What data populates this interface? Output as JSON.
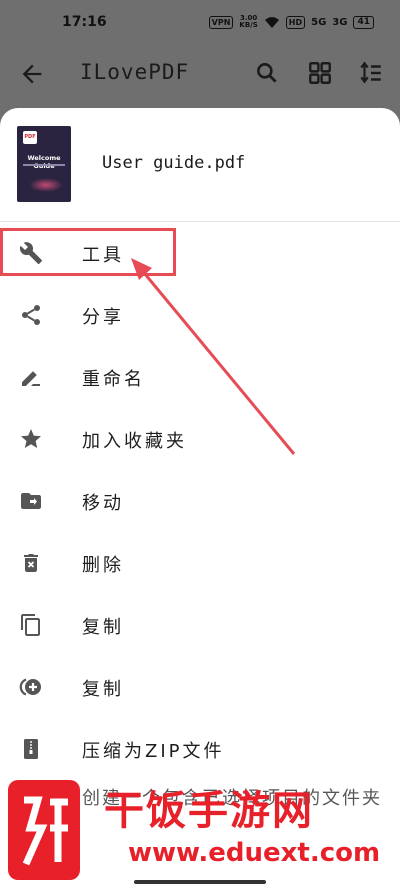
{
  "status": {
    "time": "17:16",
    "vpn": "VPN",
    "speed": "3.00\nKB/S",
    "hd": "HD",
    "net1": "5G",
    "net2": "3G",
    "battery": "41"
  },
  "appbar": {
    "title": "ILovePDF"
  },
  "file": {
    "name": "User guide.pdf",
    "thumb_title": "Welcome Guide",
    "thumb_logo": "PDF"
  },
  "menu": [
    {
      "label": "工具"
    },
    {
      "label": "分享"
    },
    {
      "label": "重命名"
    },
    {
      "label": "加入收藏夹"
    },
    {
      "label": "移动"
    },
    {
      "label": "删除"
    },
    {
      "label": "复制"
    },
    {
      "label": "复制"
    },
    {
      "label": "压缩为ZIP文件"
    }
  ],
  "overlay_item": "创建一个包含已选择项目的文件夹",
  "watermark": {
    "brand": "干饭手游网",
    "url": "www.eduext.com"
  },
  "colors": {
    "highlight": "#e74c55",
    "watermark": "#e8202a"
  }
}
